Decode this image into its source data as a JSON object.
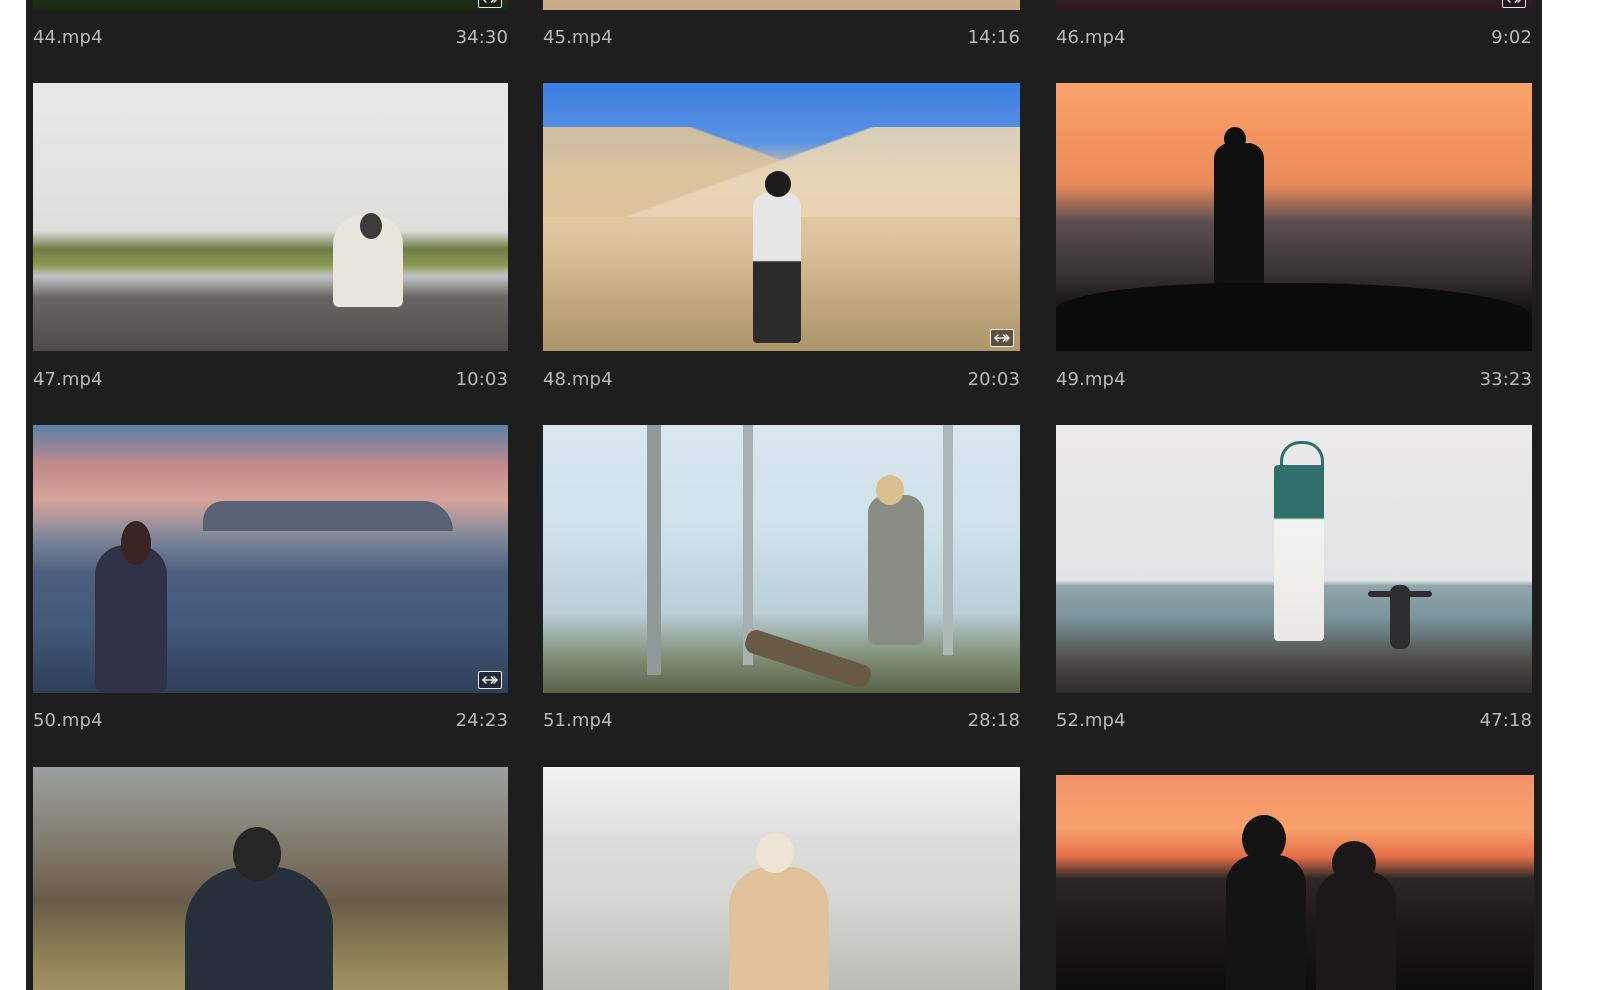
{
  "clips": [
    {
      "name": "44.mp4",
      "duration": "34:30",
      "badge": true,
      "icon": "speed-ramp-icon"
    },
    {
      "name": "45.mp4",
      "duration": "14:16",
      "badge": false
    },
    {
      "name": "46.mp4",
      "duration": "9:02",
      "badge": true,
      "icon": "speed-ramp-icon"
    },
    {
      "name": "47.mp4",
      "duration": "10:03",
      "badge": false
    },
    {
      "name": "48.mp4",
      "duration": "20:03",
      "badge": true,
      "icon": "speed-ramp-icon"
    },
    {
      "name": "49.mp4",
      "duration": "33:23",
      "badge": false
    },
    {
      "name": "50.mp4",
      "duration": "24:23",
      "badge": true,
      "icon": "speed-ramp-icon"
    },
    {
      "name": "51.mp4",
      "duration": "28:18",
      "badge": false
    },
    {
      "name": "52.mp4",
      "duration": "47:18",
      "badge": false
    },
    {
      "name": "",
      "duration": "",
      "badge": false
    },
    {
      "name": "",
      "duration": "",
      "badge": false
    },
    {
      "name": "",
      "duration": "",
      "badge": false
    }
  ],
  "colors": {
    "panel": "#1e1e1e",
    "caption": "#b9b9b9",
    "badge_border": "#e8e8e8"
  }
}
